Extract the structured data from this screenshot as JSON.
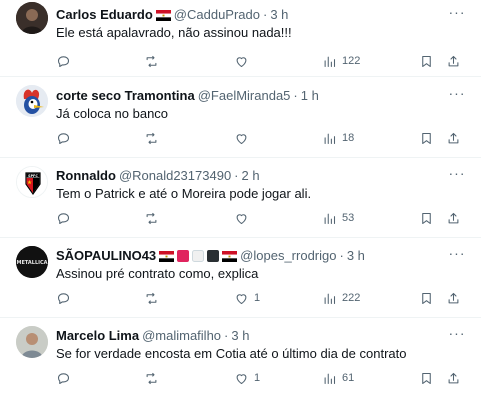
{
  "tweets": [
    {
      "name": "Carlos Eduardo",
      "handle": "@CadduPrado",
      "dot": "·",
      "time": "3 h",
      "text": "Ele está apalavrado, não assinou nada!!!",
      "likes": "",
      "views": "122",
      "avatar_icon": "person-photo",
      "flags": [
        "egypt-flag"
      ]
    },
    {
      "name": "corte seco Tramontina",
      "handle": "@FaelMiranda5",
      "dot": "·",
      "time": "1 h",
      "text": "Já coloca no banco",
      "likes": "",
      "views": "18",
      "avatar_icon": "woody-woodpecker-avatar",
      "flags": []
    },
    {
      "name": "Ronnaldo",
      "handle": "@Ronald23173490",
      "dot": "·",
      "time": "2 h",
      "text": "Tem o Patrick e até o Moreira pode jogar ali.",
      "likes": "",
      "views": "53",
      "avatar_icon": "sao-paulo-crest",
      "flags": []
    },
    {
      "name": "SÃOPAULINO43",
      "handle": "@lopes_rrodrigo",
      "dot": "·",
      "time": "3 h",
      "text": "Assinou pré contrato como, explica",
      "likes": "1",
      "views": "222",
      "avatar_icon": "metallica-logo",
      "flags": [
        "egypt-flag",
        "red-square",
        "white-square",
        "black-square",
        "egypt-flag"
      ]
    },
    {
      "name": "Marcelo Lima",
      "handle": "@malimafilho",
      "dot": "·",
      "time": "3 h",
      "text": "Se for verdade encosta em Cotia até o último dia de contrato",
      "likes": "1",
      "views": "61",
      "avatar_icon": "person-photo",
      "flags": []
    }
  ],
  "colors": {
    "text": "#0f1419",
    "secondary": "#536471",
    "divider": "#eff3f4",
    "flag_red": "#ce1126",
    "flag_black": "#000000"
  }
}
